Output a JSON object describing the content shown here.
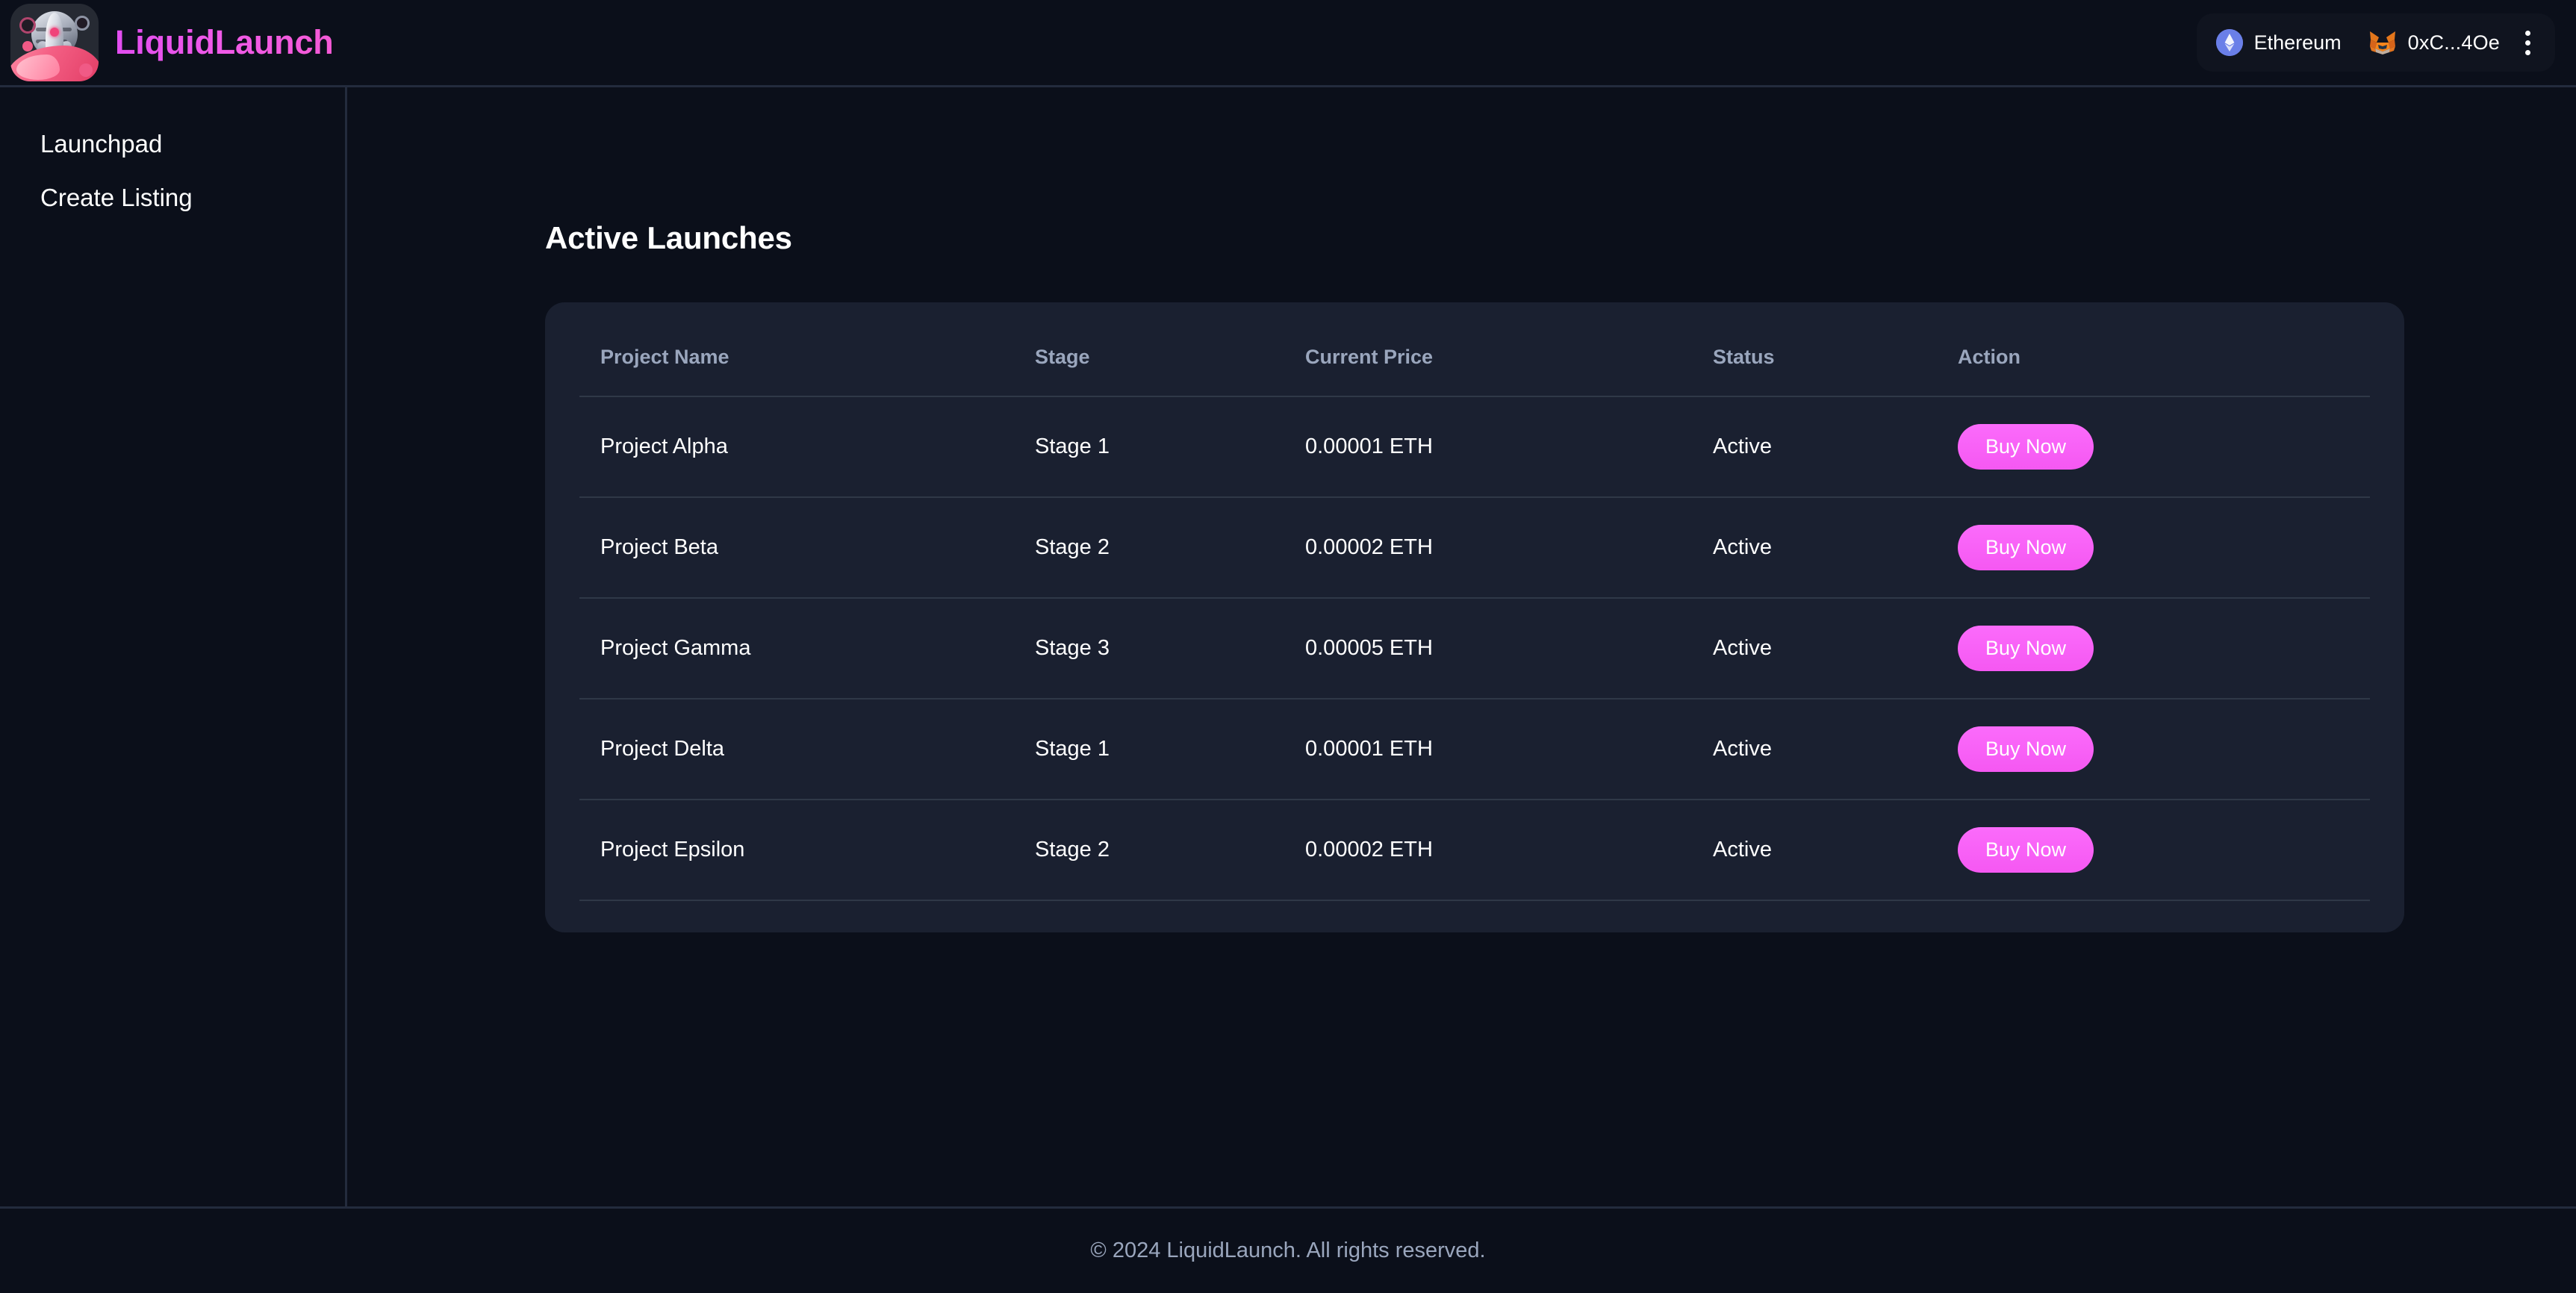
{
  "header": {
    "brand_name": "LiquidLaunch",
    "logo_icon": "rocket-liquid-logo",
    "wallet": {
      "chain_icon": "ethereum-icon",
      "chain_label": "Ethereum",
      "account_icon": "metamask-fox-icon",
      "account_label": "0xC...4Oe",
      "menu_icon": "kebab-menu-icon"
    }
  },
  "sidebar": {
    "items": [
      {
        "label": "Launchpad"
      },
      {
        "label": "Create Listing"
      }
    ]
  },
  "main": {
    "title": "Active Launches",
    "table": {
      "columns": [
        "Project Name",
        "Stage",
        "Current Price",
        "Status",
        "Action"
      ],
      "rows": [
        {
          "name": "Project Alpha",
          "stage": "Stage 1",
          "price": "0.00001 ETH",
          "status": "Active",
          "action": "Buy Now"
        },
        {
          "name": "Project Beta",
          "stage": "Stage 2",
          "price": "0.00002 ETH",
          "status": "Active",
          "action": "Buy Now"
        },
        {
          "name": "Project Gamma",
          "stage": "Stage 3",
          "price": "0.00005 ETH",
          "status": "Active",
          "action": "Buy Now"
        },
        {
          "name": "Project Delta",
          "stage": "Stage 1",
          "price": "0.00001 ETH",
          "status": "Active",
          "action": "Buy Now"
        },
        {
          "name": "Project Epsilon",
          "stage": "Stage 2",
          "price": "0.00002 ETH",
          "status": "Active",
          "action": "Buy Now"
        }
      ]
    }
  },
  "footer": {
    "text": "© 2024 LiquidLaunch. All rights reserved."
  },
  "colors": {
    "page_background": "#0b0f1a",
    "card_background": "#1a2030",
    "border": "#232b3d",
    "brand_accent": "#e855f0",
    "button_pink": "#fb6bfb",
    "muted_text": "#9aa6bd",
    "ethereum_blue": "#6a7fe8",
    "metamask_orange": "#e2761b"
  }
}
